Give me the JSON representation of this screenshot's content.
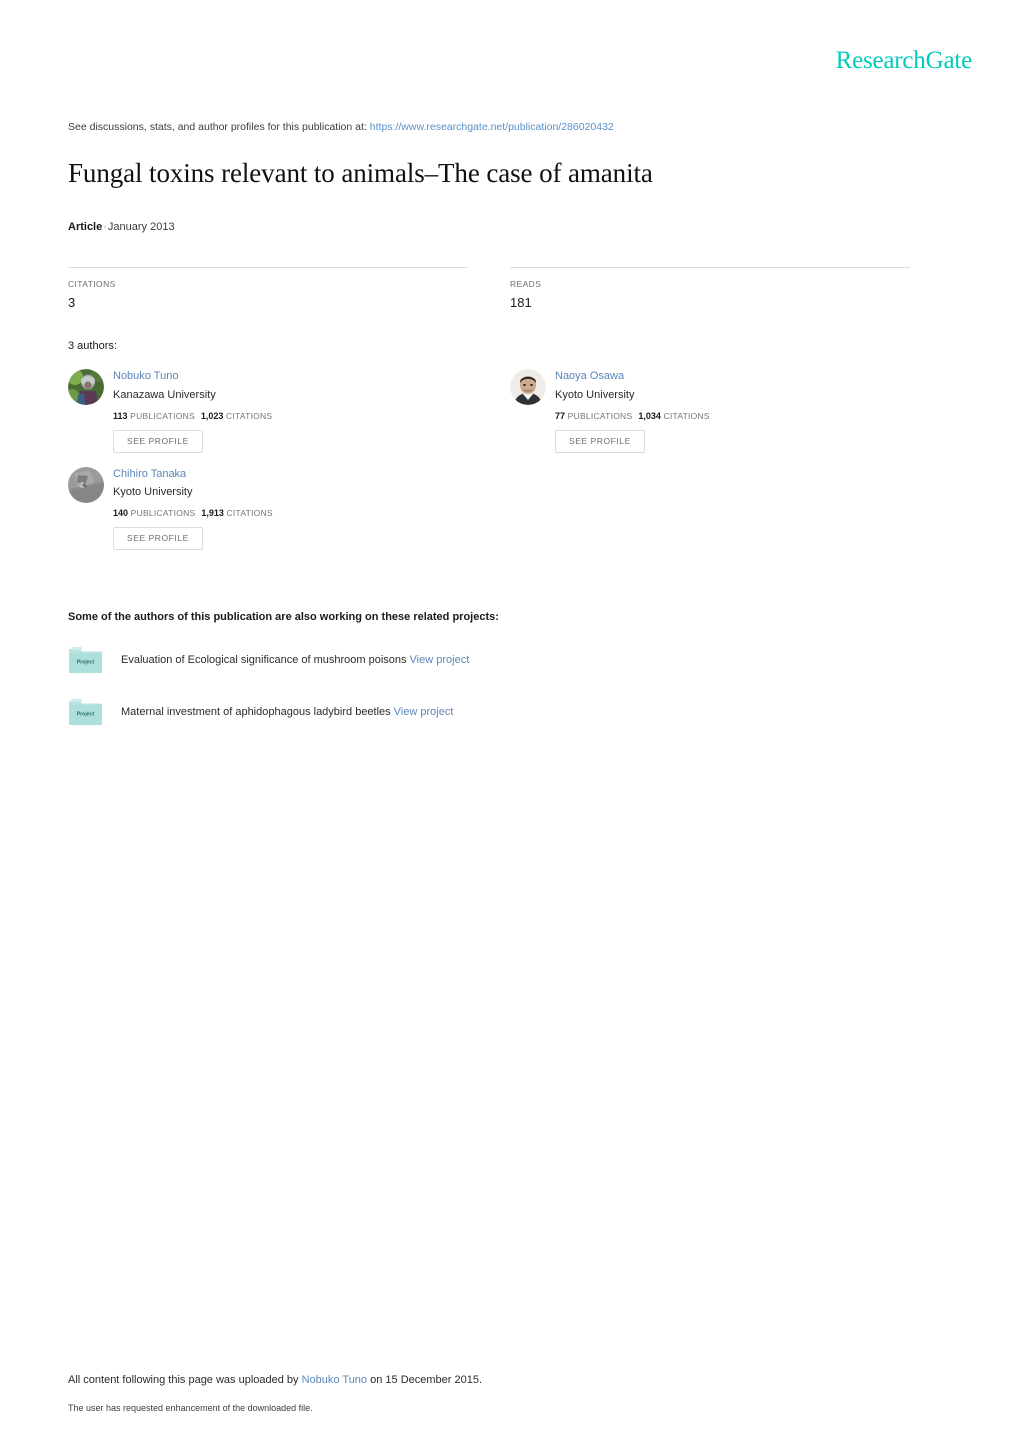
{
  "brand": {
    "name": "ResearchGate",
    "color": "#00ccbb"
  },
  "header": {
    "discussion_prefix": "See discussions, stats, and author profiles for this publication at:",
    "discussion_url": "https://www.researchgate.net/publication/286020432",
    "title": "Fungal toxins relevant to animals–The case of amanita",
    "kind": "Article",
    "separator": "·",
    "date": "January 2013"
  },
  "stats": [
    {
      "label": "CITATIONS",
      "value": "3"
    },
    {
      "label": "READS",
      "value": "181"
    }
  ],
  "authors_section": {
    "heading": "3 authors:",
    "see_profile_label": "SEE PROFILE",
    "publications_label": "PUBLICATIONS",
    "citations_label": "CITATIONS",
    "authors": [
      {
        "name": "Nobuko Tuno",
        "affiliation": "Kanazawa University",
        "publications": "113",
        "citations": "1,023",
        "avatar": "photo-outdoor-person"
      },
      {
        "name": "Naoya Osawa",
        "affiliation": "Kyoto University",
        "publications": "77",
        "citations": "1,034",
        "avatar": "photo-portrait-man"
      },
      {
        "name": "Chihiro Tanaka",
        "affiliation": "Kyoto University",
        "publications": "140",
        "citations": "1,913",
        "avatar": "photo-grayscale-abstract"
      }
    ]
  },
  "projects_section": {
    "heading": "Some of the authors of this publication are also working on these related projects:",
    "icon_caption": "Project",
    "view_label": "View project",
    "projects": [
      {
        "title": "Evaluation of Ecological significance of mushroom poisons"
      },
      {
        "title": "Maternal investment of aphidophagous ladybird beetles"
      }
    ]
  },
  "footer": {
    "upload_prefix": "All content following this page was uploaded by",
    "uploader": "Nobuko Tuno",
    "upload_suffix": "on 15 December 2015.",
    "note": "The user has requested enhancement of the downloaded file."
  }
}
